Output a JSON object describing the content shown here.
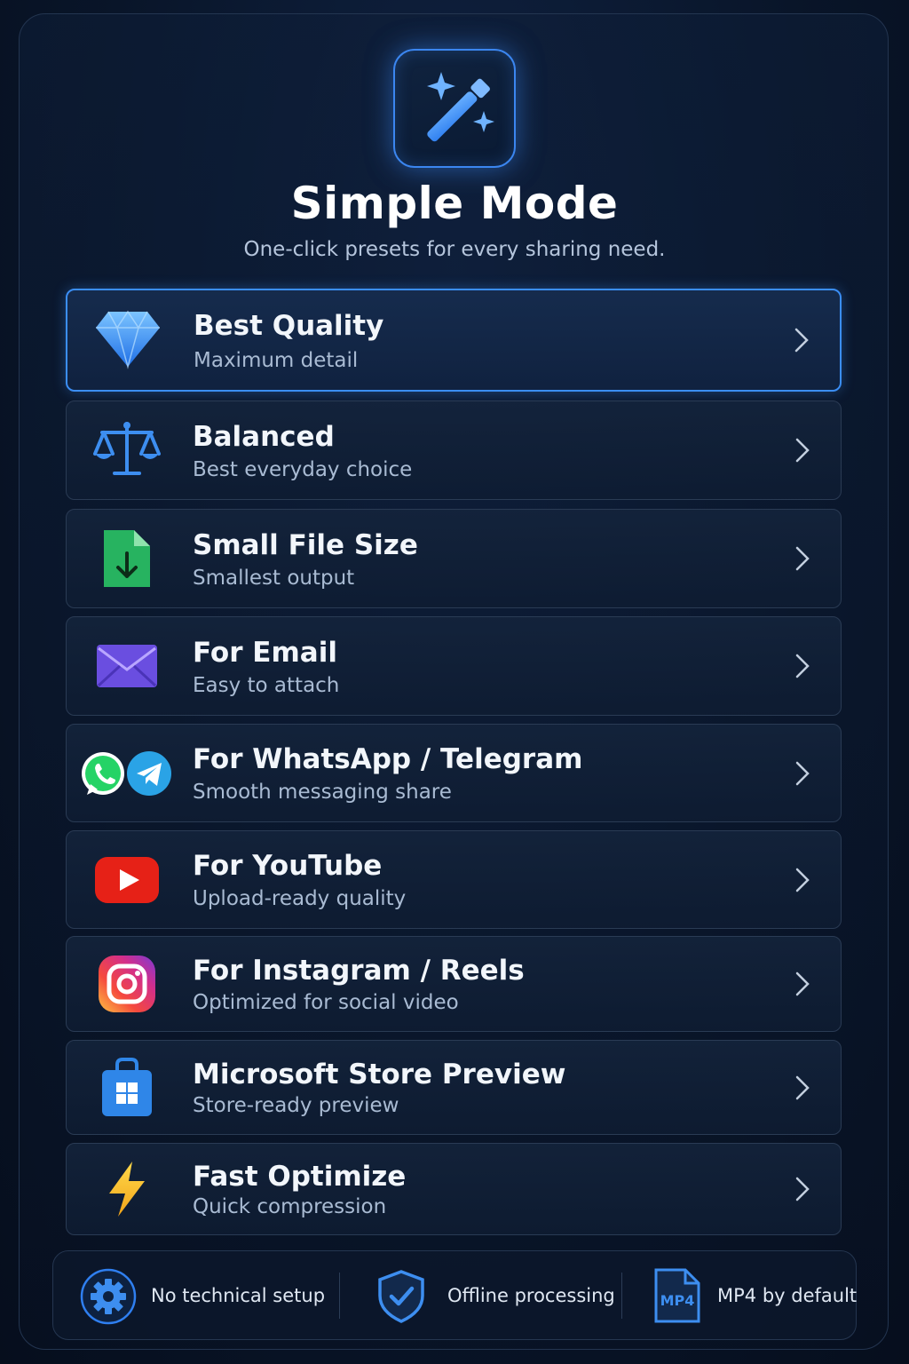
{
  "header": {
    "title": "Simple Mode",
    "subtitle": "One-click presets for every sharing need.",
    "icon": "magic-wand-icon",
    "accent_color": "#3b86f0"
  },
  "presets": [
    {
      "name": "Best Quality",
      "desc": "Maximum detail",
      "icon": "diamond-icon",
      "selected": true
    },
    {
      "name": "Balanced",
      "desc": "Best everyday choice",
      "icon": "scales-icon",
      "selected": false
    },
    {
      "name": "Small File Size",
      "desc": "Smallest output",
      "icon": "file-download-icon",
      "selected": false
    },
    {
      "name": "For Email",
      "desc": "Easy to attach",
      "icon": "envelope-icon",
      "selected": false
    },
    {
      "name": "For WhatsApp / Telegram",
      "desc": "Smooth messaging share",
      "icon": "whatsapp-telegram-icon",
      "selected": false
    },
    {
      "name": "For YouTube",
      "desc": "Upload-ready quality",
      "icon": "youtube-icon",
      "selected": false
    },
    {
      "name": "For Instagram / Reels",
      "desc": "Optimized for social video",
      "icon": "instagram-icon",
      "selected": false
    },
    {
      "name": "Microsoft Store Preview",
      "desc": "Store-ready preview",
      "icon": "store-bag-icon",
      "selected": false
    },
    {
      "name": "Fast Optimize",
      "desc": "Quick compression",
      "icon": "lightning-icon",
      "selected": false
    }
  ],
  "footer": {
    "features": [
      {
        "label": "No technical setup",
        "icon": "gear-icon"
      },
      {
        "label": "Offline processing",
        "icon": "shield-check-icon"
      },
      {
        "label": "MP4 by default",
        "icon": "mp4-file-icon",
        "badge": "MP4"
      }
    ]
  }
}
